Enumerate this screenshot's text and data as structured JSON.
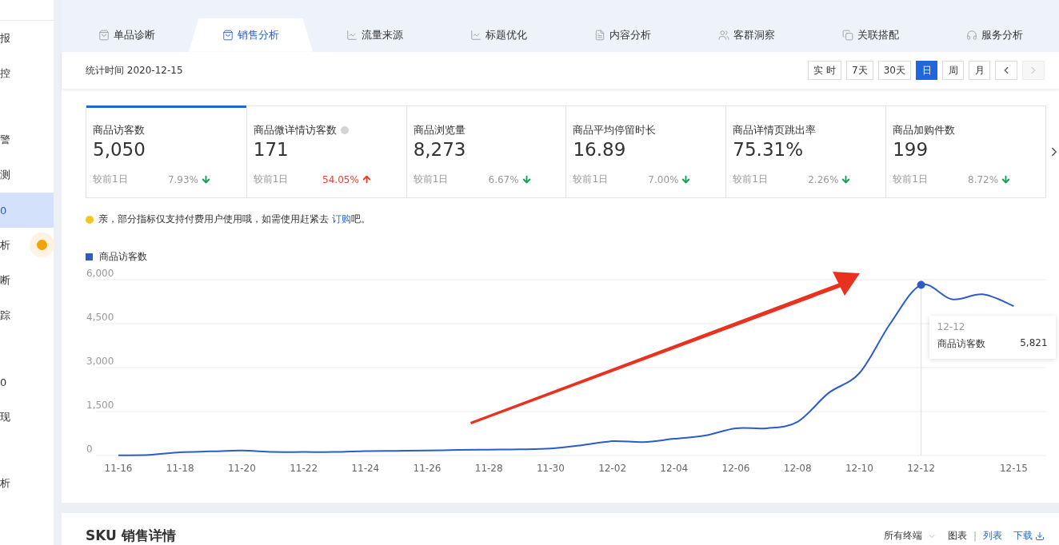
{
  "sidebar": {
    "groups": [
      {
        "items": [
          {
            "label": "报",
            "selected": false,
            "badge": false
          },
          {
            "label": "控",
            "selected": false,
            "badge": false
          }
        ]
      },
      {
        "items": [
          {
            "label": "警",
            "selected": false,
            "badge": false
          },
          {
            "label": "测",
            "selected": false,
            "badge": false
          },
          {
            "label": "0",
            "selected": true,
            "badge": false
          },
          {
            "label": "析",
            "selected": false,
            "badge": true
          },
          {
            "label": "断",
            "selected": false,
            "badge": false
          },
          {
            "label": "踪",
            "selected": false,
            "badge": false
          }
        ]
      },
      {
        "items": [
          {
            "label": "0",
            "selected": false,
            "badge": false
          },
          {
            "label": "现",
            "selected": false,
            "badge": false
          }
        ]
      },
      {
        "items": [
          {
            "label": "析",
            "selected": false,
            "badge": false
          }
        ]
      }
    ]
  },
  "tabs": [
    {
      "label": "单品诊断",
      "selected": false
    },
    {
      "label": "销售分析",
      "selected": true
    },
    {
      "label": "流量来源",
      "selected": false
    },
    {
      "label": "标题优化",
      "selected": false
    },
    {
      "label": "内容分析",
      "selected": false
    },
    {
      "label": "客群洞察",
      "selected": false
    },
    {
      "label": "关联搭配",
      "selected": false
    },
    {
      "label": "服务分析",
      "selected": false
    }
  ],
  "header": {
    "stat_time": "统计时间 2020-12-15",
    "periods": [
      {
        "label": "实 时",
        "selected": false
      },
      {
        "label": "7天",
        "selected": false
      },
      {
        "label": "30天",
        "selected": false
      },
      {
        "label": "日",
        "selected": true
      },
      {
        "label": "周",
        "selected": false
      },
      {
        "label": "月",
        "selected": false
      }
    ],
    "nav_buttons": [
      {
        "kind": "prev",
        "disabled": false
      },
      {
        "kind": "next",
        "disabled": true
      }
    ]
  },
  "metrics": [
    {
      "title": "商品访客数",
      "value": "5,050",
      "compare": "较前1日",
      "change": "7.93%",
      "rising": false,
      "selected": true,
      "info": false
    },
    {
      "title": "商品微详情访客数",
      "value": "171",
      "compare": "较前1日",
      "change": "54.05%",
      "rising": true,
      "selected": false,
      "info": true
    },
    {
      "title": "商品浏览量",
      "value": "8,273",
      "compare": "较前1日",
      "change": "6.67%",
      "rising": false,
      "selected": false,
      "info": false
    },
    {
      "title": "商品平均停留时长",
      "value": "16.89",
      "compare": "较前1日",
      "change": "7.00%",
      "rising": false,
      "selected": false,
      "info": false
    },
    {
      "title": "商品详情页跳出率",
      "value": "75.31%",
      "compare": "较前1日",
      "change": "2.26%",
      "rising": false,
      "selected": false,
      "info": false
    },
    {
      "title": "商品加购件数",
      "value": "199",
      "compare": "较前1日",
      "change": "8.72%",
      "rising": false,
      "selected": false,
      "info": false
    }
  ],
  "notice": {
    "text_before": "亲，部分指标仅支持付费用户使用哦，如需使用赶紧去 ",
    "link": "订购",
    "text_after": "吧。"
  },
  "chart": {
    "tooltip": {
      "date": "12-12",
      "label": "商品访客数",
      "value": "5,821"
    },
    "chart_data": {
      "type": "line",
      "grid": true,
      "categories": [
        "11-16",
        null,
        "11-18",
        null,
        "11-20",
        null,
        "11-22",
        null,
        "11-24",
        null,
        "11-26",
        null,
        "11-28",
        null,
        "11-30",
        null,
        "12-02",
        null,
        "12-04",
        null,
        "12-06",
        null,
        "12-08",
        null,
        "12-10",
        null,
        "12-12",
        null,
        null,
        "12-15"
      ],
      "series": [
        {
          "name": "商品访客数",
          "color": "#2b5cc8",
          "values": [
            10,
            20,
            110,
            140,
            170,
            120,
            120,
            120,
            150,
            160,
            170,
            190,
            200,
            210,
            240,
            350,
            490,
            460,
            570,
            680,
            930,
            930,
            1150,
            2130,
            2810,
            4500,
            5821,
            5330,
            5500,
            5100
          ]
        }
      ],
      "ylim": [
        0,
        6000
      ],
      "yticks": [
        {
          "value": 0,
          "label": "0"
        },
        {
          "value": 1500,
          "label": "1,500"
        },
        {
          "value": 3000,
          "label": "3,000"
        },
        {
          "value": 4500,
          "label": "4,500"
        },
        {
          "value": 6000,
          "label": "6,000"
        }
      ]
    }
  },
  "sku": {
    "title": "SKU 销售详情",
    "terminal": "所有终端",
    "views": [
      {
        "label": "图表",
        "selected": true
      },
      {
        "label": "列表",
        "selected": false
      }
    ],
    "separator": "|",
    "download": "下载"
  }
}
